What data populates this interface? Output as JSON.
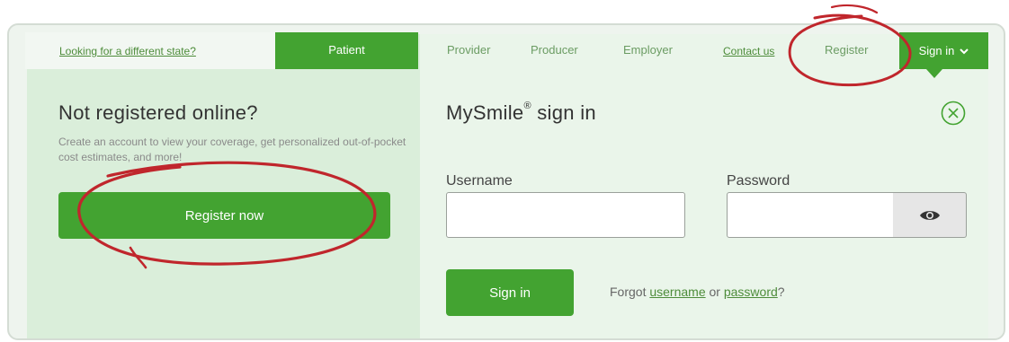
{
  "nav": {
    "state_link": "Looking for a different state?",
    "patient": "Patient",
    "provider": "Provider",
    "producer": "Producer",
    "employer": "Employer",
    "contact": "Contact us",
    "register": "Register",
    "signin": "Sign in",
    "signin_caret_icon": "chevron-down-icon"
  },
  "left": {
    "title": "Not registered online?",
    "description": "Create an account to view your coverage, get personalized out-of-pocket cost estimates, and more!",
    "register_button": "Register now"
  },
  "right": {
    "title": "MySmile",
    "title_mark": "®",
    "title_suffix": " sign in",
    "close_icon": "close-circle-icon",
    "username_label": "Username",
    "username_value": "",
    "password_label": "Password",
    "password_value": "",
    "eye_icon": "eye-icon",
    "signin_button": "Sign in",
    "forgot_prefix": "Forgot ",
    "forgot_username": "username",
    "forgot_or": " or ",
    "forgot_password": "password",
    "forgot_suffix": "?"
  },
  "colors": {
    "brand_green": "#43a331",
    "annotation_red": "#c0262c"
  }
}
